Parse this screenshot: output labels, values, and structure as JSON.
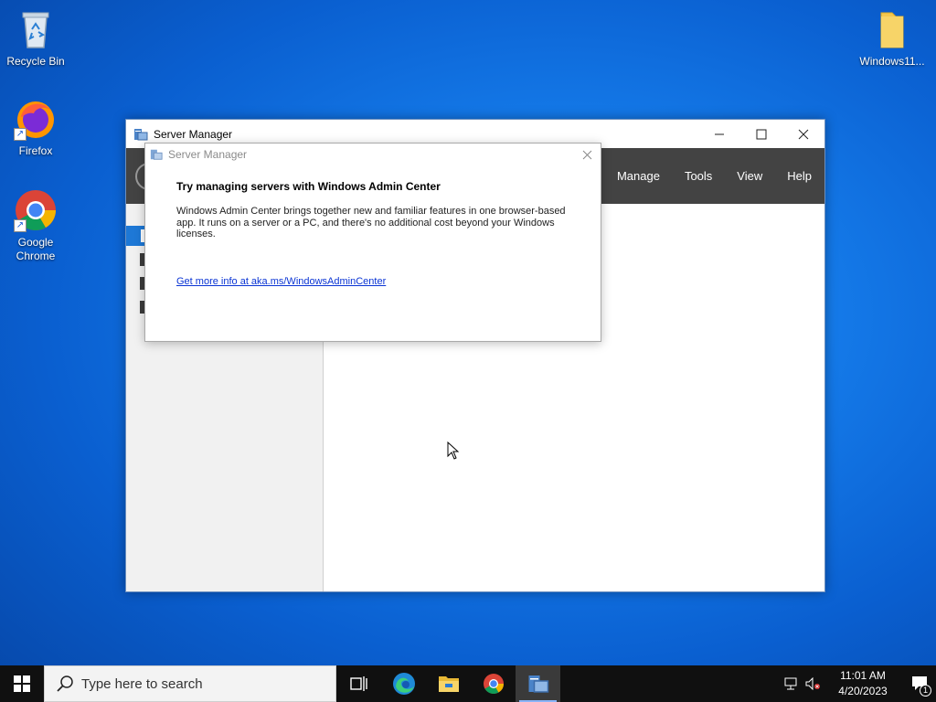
{
  "desktop": {
    "icons": [
      {
        "label": "Recycle Bin"
      },
      {
        "label": "Firefox"
      },
      {
        "label": "Google Chrome"
      },
      {
        "label": "Windows11..."
      }
    ]
  },
  "window": {
    "title": "Server Manager",
    "menu": [
      "Manage",
      "Tools",
      "View",
      "Help"
    ]
  },
  "dialog": {
    "title": "Server Manager",
    "heading": "Try managing servers with Windows Admin Center",
    "body": "Windows Admin Center brings together new and familiar features in one browser-based app. It runs on a server or a PC, and there's no additional cost beyond your Windows licenses.",
    "link": "Get more info at aka.ms/WindowsAdminCenter"
  },
  "taskbar": {
    "search_placeholder": "Type here to search",
    "time": "11:01 AM",
    "date": "4/20/2023",
    "notification_count": "1"
  },
  "colors": {
    "menubar": "#434343",
    "accent": "#1e78d6",
    "link": "#0a34d4"
  }
}
